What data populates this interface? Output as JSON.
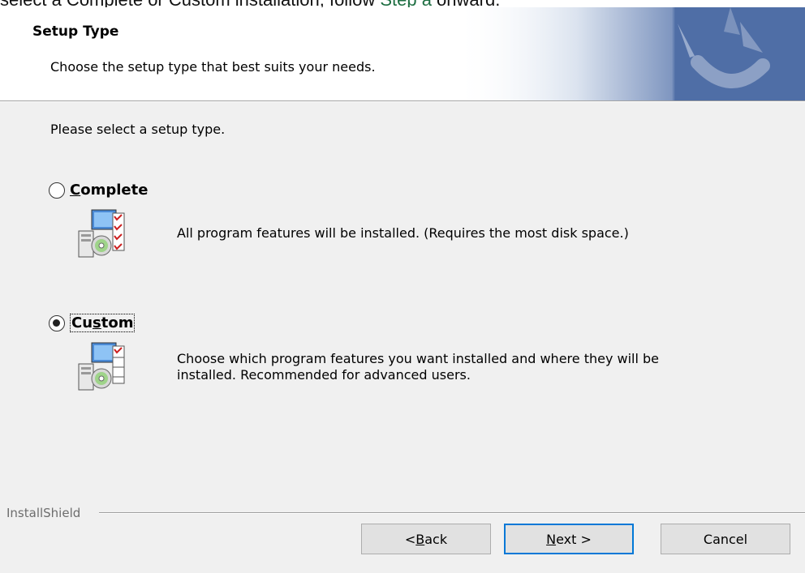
{
  "doc": {
    "line_before": "select a Complete or Custom installation, follow ",
    "link_text": "Step a",
    "line_after": " onward."
  },
  "header": {
    "title": "Setup Type",
    "subtitle": "Choose the setup type that best suits your needs."
  },
  "body": {
    "prompt": "Please select a setup type."
  },
  "options": [
    {
      "mnemonic": "C",
      "rest": "omplete",
      "description": "All program features will be installed. (Requires the most disk space.)",
      "selected": false
    },
    {
      "before": "Cu",
      "mnemonic": "s",
      "after": "tom",
      "description": "Choose which program features you want installed and where they will be installed. Recommended for advanced users.",
      "selected": true
    }
  ],
  "footer": {
    "brand": "InstallShield",
    "back": {
      "prefix": "< ",
      "mnemonic": "B",
      "rest": "ack"
    },
    "next": {
      "mnemonic": "N",
      "rest": "ext >"
    },
    "cancel": "Cancel"
  },
  "colors": {
    "dialog_bg": "#f0f0f0",
    "banner_blue": "#4f6ea6",
    "default_button_border": "#0078d7",
    "link": "#1f6f43"
  }
}
